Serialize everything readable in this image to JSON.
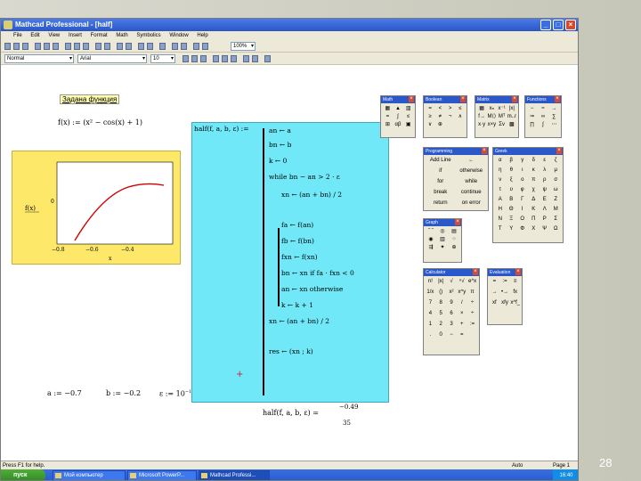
{
  "window": {
    "title": "Mathcad Professional - [half]",
    "min_btn": "_",
    "max_btn": "□",
    "close_btn": "×"
  },
  "menu": [
    "File",
    "Edit",
    "View",
    "Insert",
    "Format",
    "Math",
    "Symbolics",
    "Window",
    "Help"
  ],
  "toolbar": {
    "zoom": "100%",
    "style": "Normal",
    "font": "Arial",
    "size": "10"
  },
  "worksheet": {
    "heading": "Задана функция",
    "func_def": "f(x) := (x² − cos(x) + 1)",
    "plot": {
      "ylabel": "f(x)",
      "xlabel": "x",
      "y_tick": "0",
      "x_ticks": [
        "−0.8",
        "−0.6",
        "−0.4"
      ]
    },
    "half_header": "half(f, a, b, ε) :=",
    "program_lines": [
      "an ← a",
      "bn ← b",
      "k ← 0",
      "while bn − an > 2 · ε",
      "xn ← (an + bn) / 2",
      "fa ← f(an)",
      "fb ← f(bn)",
      "fxn ← f(xn)",
      "bn ← xn  if  fa · fxn < 0",
      "an ← xn  otherwise",
      "k ← k + 1",
      "xn ← (an + bn) / 2",
      "res ← (xn ; k)"
    ],
    "a_def": "a := −0.7",
    "b_def": "b := −0.2",
    "eps_def": "ε := 10",
    "eps_exp": "−1",
    "result_call": "half(f, a, b, ε) =",
    "result_top": "−0.49",
    "result_bottom": "35",
    "plus_mark": "+"
  },
  "palettes": {
    "math_title": "Math",
    "boolean_title": "Boolean",
    "matrix_title": "Matrix",
    "functions_title": "Functions",
    "programming_title": "Programming",
    "greek_title": "Greek",
    "graph_title": "Graph",
    "calculator_title": "Calculator",
    "evaluation_title": "Evaluation",
    "programming_items": [
      "Add Line",
      "←",
      "if",
      "otherwise",
      "for",
      "while",
      "break",
      "continue",
      "return",
      "on error"
    ],
    "boolean_items": [
      "=",
      "<",
      ">",
      "≤",
      "≥",
      "≠",
      "¬",
      "∧",
      "∨",
      "⊕"
    ],
    "greek_items": [
      "α",
      "β",
      "γ",
      "δ",
      "ε",
      "ζ",
      "η",
      "θ",
      "ι",
      "κ",
      "λ",
      "μ",
      "ν",
      "ξ",
      "ο",
      "π",
      "ρ",
      "σ",
      "τ",
      "υ",
      "φ",
      "χ",
      "ψ",
      "ω",
      "Α",
      "Β",
      "Γ",
      "Δ",
      "Ε",
      "Ζ",
      "Η",
      "Θ",
      "Ι",
      "Κ",
      "Λ",
      "Μ",
      "Ν",
      "Ξ",
      "Ο",
      "Π",
      "Ρ",
      "Σ",
      "Τ",
      "Υ",
      "Φ",
      "Χ",
      "Ψ",
      "Ω"
    ],
    "calc_items": [
      "n!",
      "|x|",
      "√",
      "ⁿ√",
      "e^x",
      "1/x",
      "()",
      "x²",
      "x^y",
      "π",
      "7",
      "8",
      "9",
      "/",
      "÷",
      "4",
      "5",
      "6",
      "×",
      "÷",
      "1",
      "2",
      "3",
      "+",
      ":=",
      ".",
      "0",
      "−",
      "="
    ],
    "eval_items": [
      "=",
      ":=",
      "≡",
      "→",
      "•→",
      "fx",
      "xf",
      "xfy",
      "x^f_y"
    ]
  },
  "status": {
    "hint": "Press F1 for help.",
    "mode": "Auto",
    "page": "Page 1"
  },
  "taskbar": {
    "start": "пуск",
    "tasks": [
      "Мой компьютер",
      "Microsoft PowerP...",
      "Mathcad Professi..."
    ],
    "clock": "16:40"
  },
  "slide_number": "28"
}
